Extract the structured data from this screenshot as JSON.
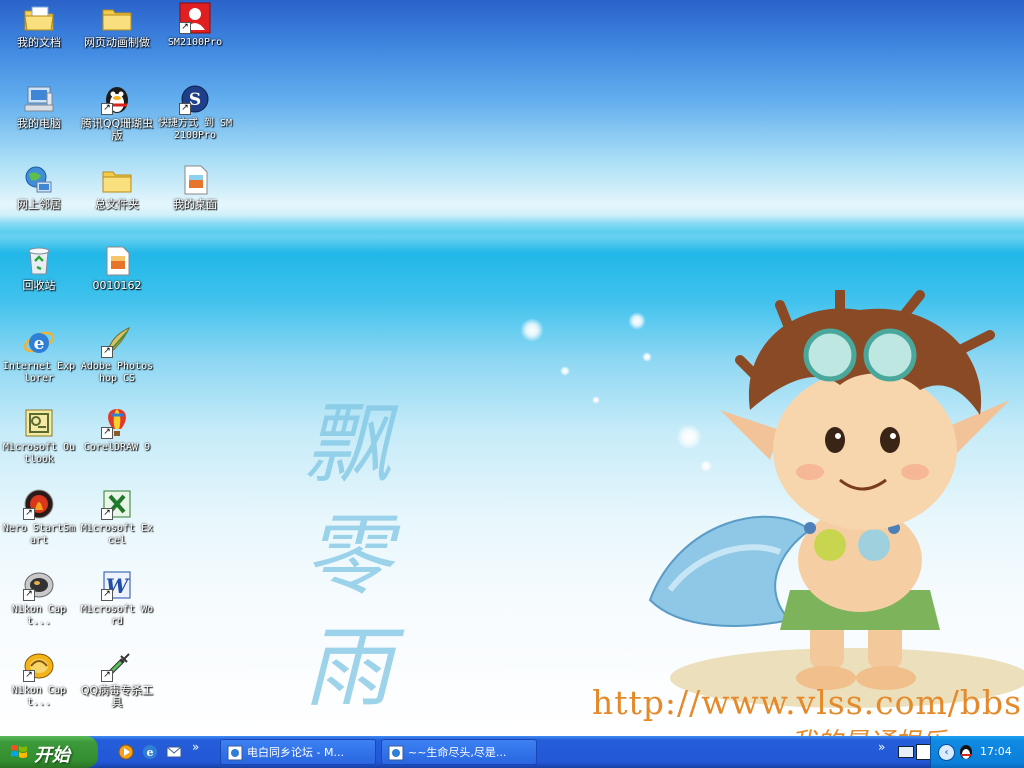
{
  "desktop": {
    "icons": [
      {
        "label": "我的文档"
      },
      {
        "label": "网页动画制做"
      },
      {
        "label": "SM2100Pro"
      },
      {
        "label": "我的电脑"
      },
      {
        "label": "腾讯QQ珊瑚虫版"
      },
      {
        "label": "快捷方式 到 SM2100Pro"
      },
      {
        "label": "网上邻居"
      },
      {
        "label": "总文件夹"
      },
      {
        "label": "我的桌面"
      },
      {
        "label": "回收站"
      },
      {
        "label": "0010162"
      },
      {
        "label": "Internet Explorer"
      },
      {
        "label": "Adobe Photoshop CS"
      },
      {
        "label": "Microsoft Outlook"
      },
      {
        "label": "CorelDRAW 9"
      },
      {
        "label": "Nero StartSmart"
      },
      {
        "label": "Microsoft Excel"
      },
      {
        "label": "Nikon Capt..."
      },
      {
        "label": "Microsoft Word"
      },
      {
        "label": "Nikon Capt..."
      },
      {
        "label": "QQ病毒专杀工具"
      }
    ],
    "wallpaper": {
      "watermark": "飘零雨",
      "url": "http://www.vlss.com/bbs",
      "subtitle": "我的最通根乐"
    }
  },
  "taskbar": {
    "start_label": "开始",
    "quick_launch": [
      "media-player-icon",
      "internet-explorer-icon",
      "outlook-express-icon"
    ],
    "quick_launch_more": "»",
    "tasks": [
      {
        "label": "电白同乡论坛 - M..."
      },
      {
        "label": "~~生命尽头,尽是..."
      }
    ],
    "tray_more": "»",
    "clock": "17:04"
  },
  "colors": {
    "taskbar": "#245edb",
    "start": "#3d9a3a",
    "tray": "#0f8ae2",
    "url_text": "#e58a2a"
  }
}
